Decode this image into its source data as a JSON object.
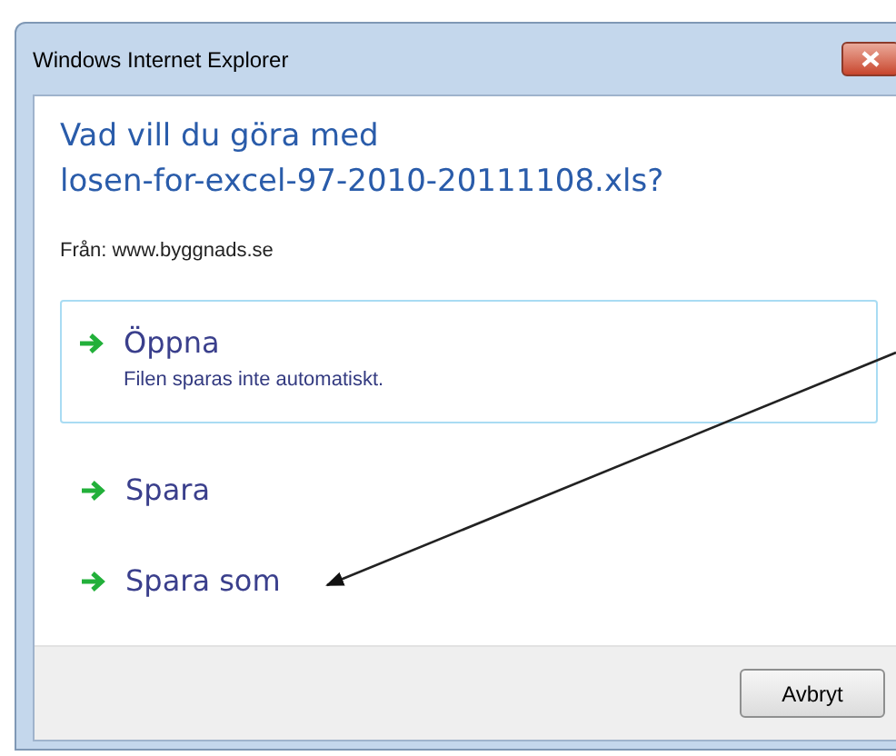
{
  "window": {
    "title": "Windows Internet Explorer"
  },
  "heading": [
    "Vad vill du göra med",
    "losen-for-excel-97-2010-20111108.xls?"
  ],
  "source": "Från: www.byggnads.se",
  "options": [
    {
      "label": "Öppna",
      "description": "Filen sparas inte automatiskt.",
      "highlighted": true
    },
    {
      "label": "Spara",
      "highlighted": false
    },
    {
      "label": "Spara som",
      "highlighted": false
    }
  ],
  "buttons": [
    "Avbryt"
  ]
}
